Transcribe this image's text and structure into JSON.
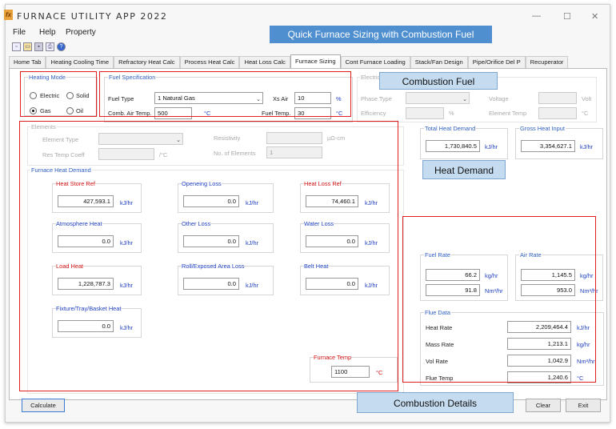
{
  "app": {
    "title": "FURNACE UTILITY APP 2022",
    "logo": "fx",
    "window_controls": {
      "minimize": "—",
      "maximize": "☐",
      "close": "✕"
    }
  },
  "menu": [
    "File",
    "Help",
    "Property"
  ],
  "tabs": [
    "Home Tab",
    "Heating Cooling Time",
    "Refractory Heat Calc",
    "Process Heat Calc",
    "Heat Loss Calc",
    "Furnace Sizing",
    "Cont Furnace Loading",
    "Stack/Fan Design",
    "Pipe/Orifice Del P",
    "Recuperator"
  ],
  "active_tab": "Furnace Sizing",
  "heating_mode": {
    "label": "Heating Mode",
    "options": [
      "Electric",
      "Solid",
      "Gas",
      "Oil"
    ],
    "selected": "Gas"
  },
  "fuel_spec": {
    "label": "Fuel Specification",
    "fuel_type_label": "Fuel Type",
    "fuel_type_value": "1 Natural Gas",
    "xs_air_label": "Xs Air",
    "xs_air_value": "10",
    "xs_air_unit": "%",
    "comb_air_temp_label": "Comb. Air Temp.",
    "comb_air_temp_value": "500",
    "comb_air_temp_unit": "°C",
    "fuel_temp_label": "Fuel Temp.",
    "fuel_temp_value": "30",
    "fuel_temp_unit": "°C"
  },
  "electrical": {
    "label": "Electrical",
    "phase_type_label": "Phase Type",
    "voltage_label": "Voltage",
    "voltage_unit": "Volt",
    "efficiency_label": "Efficiency",
    "efficiency_unit": "%",
    "element_temp_label": "Element Temp",
    "element_temp_unit": "°C"
  },
  "elements": {
    "label": "Elements",
    "element_type_label": "Element Type",
    "resistivity_label": "Resistivity",
    "resistivity_unit": "µΩ-cm",
    "res_temp_coeff_label": "Res Temp Coeff",
    "res_temp_coeff_unit": "/°C",
    "no_elements_label": "No. of Elements",
    "no_elements_value": "1"
  },
  "heat_demand_summary": {
    "total_label": "Total Heat Demand",
    "total_value": "1,730,840.5",
    "gross_label": "Gross Heat Input",
    "gross_value": "3,354,627.1",
    "unit": "kJ/hr"
  },
  "furnace_heat_demand": {
    "label": "Furnace Heat Demand",
    "unit": "kJ/hr",
    "items": {
      "heat_store_ref": {
        "label": "Heat Store Ref",
        "value": "427,593.1"
      },
      "opening_loss": {
        "label": "Openeing Loss",
        "value": "0.0"
      },
      "heat_loss_ref": {
        "label": "Heat Loss Ref",
        "value": "74,460.1"
      },
      "atmosphere_heat": {
        "label": "Atmosphere Heat",
        "value": "0.0"
      },
      "other_loss": {
        "label": "Other Loss",
        "value": "0.0"
      },
      "water_loss": {
        "label": "Water Loss",
        "value": "0.0"
      },
      "load_heat": {
        "label": "Load Heat",
        "value": "1,228,787.3"
      },
      "roll_exposed": {
        "label": "Roll/Exposed Area Loss",
        "value": "0.0"
      },
      "belt_heat": {
        "label": "Belt Heat",
        "value": "0.0"
      },
      "fixture_heat": {
        "label": "Fixture/Tray/Basket Heat",
        "value": "0.0"
      }
    },
    "furnace_temp_label": "Furnace Temp",
    "furnace_temp_value": "1100",
    "furnace_temp_unit": "°C"
  },
  "fuel_rate": {
    "label": "Fuel Rate",
    "mass_value": "66.2",
    "mass_unit": "kg/hr",
    "vol_value": "91.8",
    "vol_unit": "Nm³/hr"
  },
  "air_rate": {
    "label": "Air Rate",
    "mass_value": "1,145.5",
    "mass_unit": "kg/hr",
    "vol_value": "953.0",
    "vol_unit": "Nm³/hr"
  },
  "flue_data": {
    "label": "Flue Data",
    "rows": [
      {
        "label": "Heat Rate",
        "value": "2,209,464.4",
        "unit": "kJ/hr"
      },
      {
        "label": "Mass Rate",
        "value": "1,213.1",
        "unit": "kg/hr"
      },
      {
        "label": "Vol Rate",
        "value": "1,042.9",
        "unit": "Nm³/hr"
      },
      {
        "label": "Flue Temp",
        "value": "1,240.6",
        "unit": "°C"
      }
    ]
  },
  "buttons": {
    "calculate": "Calculate",
    "clear": "Clear",
    "exit": "Exit"
  },
  "annotations": {
    "banner": "Quick Furnace Sizing with Combustion Fuel",
    "combustion_fuel": "Combustion Fuel",
    "heat_demand": "Heat Demand",
    "combustion_details": "Combustion Details"
  },
  "colors": {
    "highlight": "#e02020",
    "callout": "#c5dcf0",
    "banner": "#4f8fcf",
    "group_label": "#3060c0",
    "unit": "#2040c0"
  }
}
